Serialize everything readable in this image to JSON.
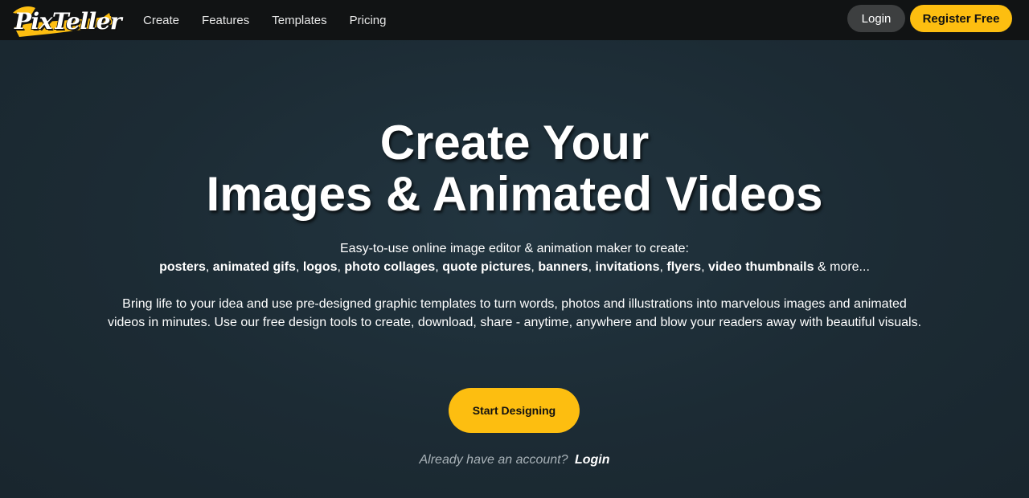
{
  "header": {
    "logo_text": "PixTeller",
    "nav": [
      "Create",
      "Features",
      "Templates",
      "Pricing"
    ],
    "login_label": "Login",
    "register_label": "Register Free"
  },
  "hero": {
    "title_line1": "Create Your",
    "title_line2": "Images & Animated Videos",
    "subtitle": "Easy-to-use online image editor & animation maker to create:",
    "features": [
      {
        "text": "posters",
        "bold": true
      },
      {
        "text": ", ",
        "bold": false
      },
      {
        "text": "animated gifs",
        "bold": true
      },
      {
        "text": ", ",
        "bold": false
      },
      {
        "text": "logos",
        "bold": true
      },
      {
        "text": ", ",
        "bold": false
      },
      {
        "text": "photo collages",
        "bold": true
      },
      {
        "text": ", ",
        "bold": false
      },
      {
        "text": "quote pictures",
        "bold": true
      },
      {
        "text": ", ",
        "bold": false
      },
      {
        "text": "banners",
        "bold": true
      },
      {
        "text": ", ",
        "bold": false
      },
      {
        "text": "invitations",
        "bold": true
      },
      {
        "text": ", ",
        "bold": false
      },
      {
        "text": "flyers",
        "bold": true
      },
      {
        "text": ", ",
        "bold": false
      },
      {
        "text": "video thumbnails",
        "bold": true
      },
      {
        "text": " & more...",
        "bold": false
      }
    ],
    "description": "Bring life to your idea and use pre-designed graphic templates to turn words, photos and illustrations into marvelous images and animated videos in minutes. Use our free design tools to create, download, share - anytime, anywhere and blow your readers away with beautiful visuals.",
    "cta_label": "Start Designing",
    "already_text": "Already have an account?",
    "already_login": "Login"
  },
  "colors": {
    "accent": "#fdbe10",
    "topbar": "#111314",
    "background": "#1c2a33"
  }
}
